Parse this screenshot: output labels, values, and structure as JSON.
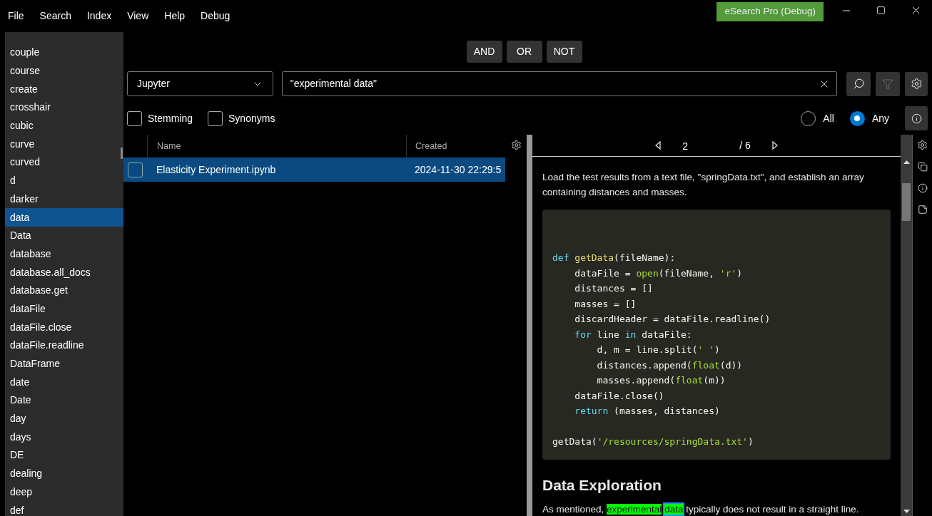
{
  "menu": [
    "File",
    "Search",
    "Index",
    "View",
    "Help",
    "Debug"
  ],
  "app_title": "eSearch Pro (Debug)",
  "operators": [
    "AND",
    "OR",
    "NOT"
  ],
  "source_dropdown": {
    "value": "Jupyter"
  },
  "search": {
    "value": "\"experimental data\""
  },
  "options": [
    {
      "label": "Stemming",
      "checked": false
    },
    {
      "label": "Synonyms",
      "checked": false
    }
  ],
  "match_mode": [
    {
      "label": "All",
      "selected": false
    },
    {
      "label": "Any",
      "selected": true
    }
  ],
  "sidebar": {
    "items": [
      {
        "label": "couple",
        "selected": false
      },
      {
        "label": "course",
        "selected": false
      },
      {
        "label": "create",
        "selected": false
      },
      {
        "label": "crosshair",
        "selected": false
      },
      {
        "label": "cubic",
        "selected": false
      },
      {
        "label": "curve",
        "selected": false
      },
      {
        "label": "curved",
        "selected": false
      },
      {
        "label": "d",
        "selected": false
      },
      {
        "label": "darker",
        "selected": false
      },
      {
        "label": "data",
        "selected": true
      },
      {
        "label": "Data",
        "selected": false
      },
      {
        "label": "database",
        "selected": false
      },
      {
        "label": "database.all_docs",
        "selected": false
      },
      {
        "label": "database.get",
        "selected": false
      },
      {
        "label": "dataFile",
        "selected": false
      },
      {
        "label": "dataFile.close",
        "selected": false
      },
      {
        "label": "dataFile.readline",
        "selected": false
      },
      {
        "label": "DataFrame",
        "selected": false
      },
      {
        "label": "date",
        "selected": false
      },
      {
        "label": "Date",
        "selected": false
      },
      {
        "label": "day",
        "selected": false
      },
      {
        "label": "days",
        "selected": false
      },
      {
        "label": "DE",
        "selected": false
      },
      {
        "label": "dealing",
        "selected": false
      },
      {
        "label": "deep",
        "selected": false
      },
      {
        "label": "def",
        "selected": false
      }
    ]
  },
  "results": {
    "columns": [
      "Name",
      "Created"
    ],
    "rows": [
      {
        "checked": false,
        "selected": true,
        "cells": [
          "Elasticity Experiment.ipynb",
          "2024-11-30 22:29:5"
        ]
      }
    ]
  },
  "preview": {
    "page": "2",
    "total": "/ 6",
    "intro": "Load the test results from a text file, \"springData.txt\", and establish an array containing distances and masses.",
    "code": [
      [
        [
          {
            "kind": "keyword",
            "text": "def"
          },
          {
            "kind": "function",
            "text": " getData"
          },
          {
            "kind": "plain",
            "text": "(fileName):"
          }
        ],
        [
          {
            "kind": "plain",
            "text": "    dataFile = "
          },
          {
            "kind": "builtin",
            "text": "open"
          },
          {
            "kind": "plain",
            "text": "(fileName, "
          },
          {
            "kind": "string",
            "text": "'r'"
          },
          {
            "kind": "plain",
            "text": ")"
          }
        ],
        [
          {
            "kind": "plain",
            "text": "    distances = []"
          }
        ],
        [
          {
            "kind": "plain",
            "text": "    masses = []"
          }
        ],
        [
          {
            "kind": "plain",
            "text": "    discardHeader = dataFile.readline()"
          }
        ],
        [
          {
            "kind": "keyword",
            "text": "    for"
          },
          {
            "kind": "plain",
            "text": " line "
          },
          {
            "kind": "keyword",
            "text": "in"
          },
          {
            "kind": "plain",
            "text": " dataFile:"
          }
        ],
        [
          {
            "kind": "plain",
            "text": "        d, m = line.split("
          },
          {
            "kind": "string",
            "text": "' '"
          },
          {
            "kind": "plain",
            "text": ")"
          }
        ],
        [
          {
            "kind": "plain",
            "text": "        distances.append("
          },
          {
            "kind": "builtin",
            "text": "float"
          },
          {
            "kind": "plain",
            "text": "(d))"
          }
        ],
        [
          {
            "kind": "plain",
            "text": "        masses.append("
          },
          {
            "kind": "builtin",
            "text": "float"
          },
          {
            "kind": "plain",
            "text": "(m))"
          }
        ],
        [
          {
            "kind": "plain",
            "text": "    dataFile.close()"
          }
        ],
        [
          {
            "kind": "keyword",
            "text": "    return"
          },
          {
            "kind": "plain",
            "text": " (masses, distances)"
          }
        ]
      ],
      [
        [
          {
            "kind": "plain",
            "text": "getData("
          },
          {
            "kind": "string",
            "text": "'/resources/springData.txt'"
          },
          {
            "kind": "plain",
            "text": ")"
          }
        ]
      ]
    ],
    "heading": "Data Exploration",
    "paragraph": [
      {
        "kind": "plain",
        "text": "As mentioned, "
      },
      {
        "kind": "match",
        "text": "experimental "
      },
      {
        "kind": "current_match",
        "text": "data"
      },
      {
        "kind": "plain",
        "text": " typically does not result in a straight line."
      }
    ]
  }
}
